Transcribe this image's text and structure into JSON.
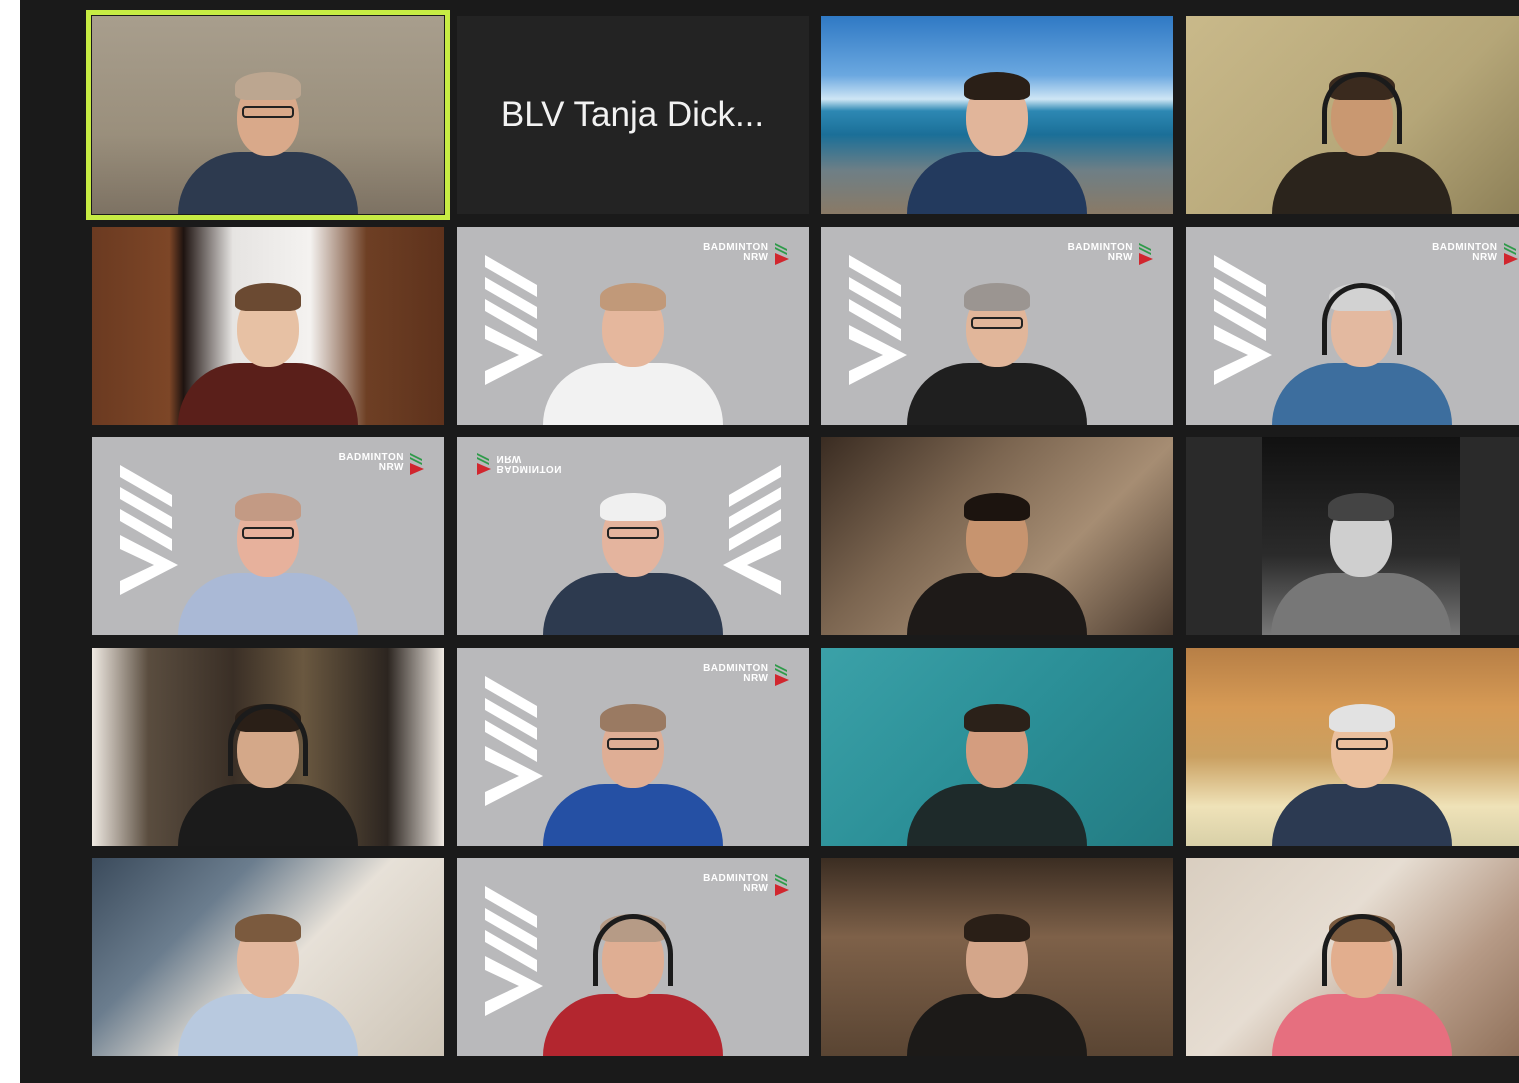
{
  "meeting": {
    "view": "gallery",
    "columns": 4,
    "rows": 5,
    "speaking_highlight_color": "#c7ec44",
    "brand_colors": {
      "background": "#b9b9bb",
      "mark_green": "#2f9a4a",
      "mark_red": "#d1262e"
    },
    "tiles": [
      {
        "kind": "video",
        "scene": "bg-wood-light",
        "shirt": "#2d3a4f",
        "skin": "#d9a98a",
        "hair": "#bca690",
        "glasses": true,
        "speaking": true
      },
      {
        "kind": "name",
        "name": "BLV Tanja Dick..."
      },
      {
        "kind": "video",
        "scene": "bg-beach",
        "shirt": "#233a5e",
        "skin": "#e1b59a",
        "hair": "#2a1f17",
        "glasses": false
      },
      {
        "kind": "video",
        "scene": "bg-warm",
        "shirt": "#2b241c",
        "skin": "#c99871",
        "hair": "#3a2a1e",
        "headset": true
      },
      {
        "kind": "video",
        "scene": "bg-door",
        "shirt": "#5a1f1a",
        "skin": "#e7c1a4",
        "hair": "#6b4a32"
      },
      {
        "kind": "brand",
        "shirt": "#f2f2f2",
        "skin": "#e5b79d",
        "hair": "#c19979",
        "logo": "BADMINTON NRW"
      },
      {
        "kind": "brand",
        "shirt": "#1f1f1f",
        "skin": "#e1b69a",
        "hair": "#9b9591",
        "glasses": true,
        "logo": "BADMINTON NRW"
      },
      {
        "kind": "brand",
        "shirt": "#3d6e9e",
        "skin": "#e3b9a0",
        "hair": "#d2d2d2",
        "headset": true,
        "logo": "BADMINTON NRW"
      },
      {
        "kind": "brand",
        "shirt": "#aab9d6",
        "skin": "#e7b19c",
        "hair": "#c39a84",
        "glasses": true,
        "logo": "BADMINTON NRW"
      },
      {
        "kind": "brand-mirrored",
        "shirt": "#2d3a4f",
        "skin": "#e4b49e",
        "hair": "#f0f0f0",
        "glasses": true,
        "logo": "BADMINTON NRW"
      },
      {
        "kind": "video",
        "scene": "bg-room-dark",
        "shirt": "#1e1a18",
        "skin": "#c7946f",
        "hair": "#1c140f"
      },
      {
        "kind": "bw",
        "shirt": "#777777",
        "skin": "#cfcfcf",
        "hair": "#444444"
      },
      {
        "kind": "video",
        "scene": "bg-paris",
        "shirt": "#1b1b1b",
        "skin": "#d4a889",
        "hair": "#2a1f17",
        "headset": true
      },
      {
        "kind": "brand",
        "shirt": "#2550a4",
        "skin": "#dfae95",
        "hair": "#9a7a62",
        "glasses": true,
        "logo": "BADMINTON NRW"
      },
      {
        "kind": "video",
        "scene": "bg-teal",
        "shirt": "#1e2a2a",
        "skin": "#d49d7f",
        "hair": "#2b2119"
      },
      {
        "kind": "video",
        "scene": "bg-shelf",
        "shirt": "#2c3a52",
        "skin": "#ebc09e",
        "hair": "#e2e2e2",
        "glasses": true
      },
      {
        "kind": "video",
        "scene": "bg-office",
        "shirt": "#b8c9df",
        "skin": "#e3b79d",
        "hair": "#7b5a3e"
      },
      {
        "kind": "brand",
        "shirt": "#b3262f",
        "skin": "#dfae93",
        "hair": "#b69b86",
        "headset": true,
        "logo": "BADMINTON NRW"
      },
      {
        "kind": "video",
        "scene": "bg-living",
        "shirt": "#1c1a18",
        "skin": "#d4a68a",
        "hair": "#2a1f17"
      },
      {
        "kind": "video",
        "scene": "bg-attic",
        "shirt": "#e66f7f",
        "skin": "#e2ae8e",
        "hair": "#7a5a3e",
        "headset": true
      }
    ]
  }
}
